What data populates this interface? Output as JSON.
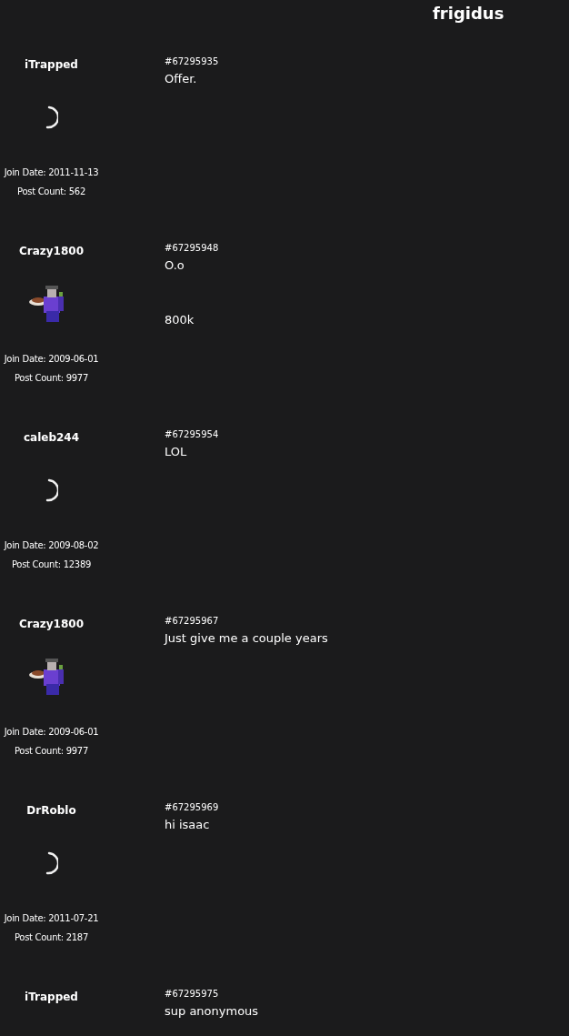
{
  "thread_title": "frigidus",
  "posts": [
    {
      "username": "iTrapped",
      "avatar": {
        "kind": "loading"
      },
      "join_date": "Join Date: 2011-11-13",
      "post_count": "Post Count: 562",
      "post_id": "#67295935",
      "paragraphs": [
        "Offer."
      ]
    },
    {
      "username": "Crazy1800",
      "avatar": {
        "kind": "picture"
      },
      "join_date": "Join Date: 2009-06-01",
      "post_count": "Post Count: 9977",
      "post_id": "#67295948",
      "paragraphs": [
        "O.o",
        "800k"
      ]
    },
    {
      "username": "caleb244",
      "avatar": {
        "kind": "loading"
      },
      "join_date": "Join Date: 2009-08-02",
      "post_count": "Post Count: 12389",
      "post_id": "#67295954",
      "paragraphs": [
        "LOL"
      ]
    },
    {
      "username": "Crazy1800",
      "avatar": {
        "kind": "picture"
      },
      "join_date": "Join Date: 2009-06-01",
      "post_count": "Post Count: 9977",
      "post_id": "#67295967",
      "paragraphs": [
        "Just give me a couple years"
      ]
    },
    {
      "username": "DrRoblo",
      "avatar": {
        "kind": "loading"
      },
      "join_date": "Join Date: 2011-07-21",
      "post_count": "Post Count: 2187",
      "post_id": "#67295969",
      "paragraphs": [
        "hi isaac"
      ]
    },
    {
      "username": "iTrapped",
      "post_id": "#67295975",
      "paragraphs": [
        "sup anonymous"
      ]
    }
  ]
}
